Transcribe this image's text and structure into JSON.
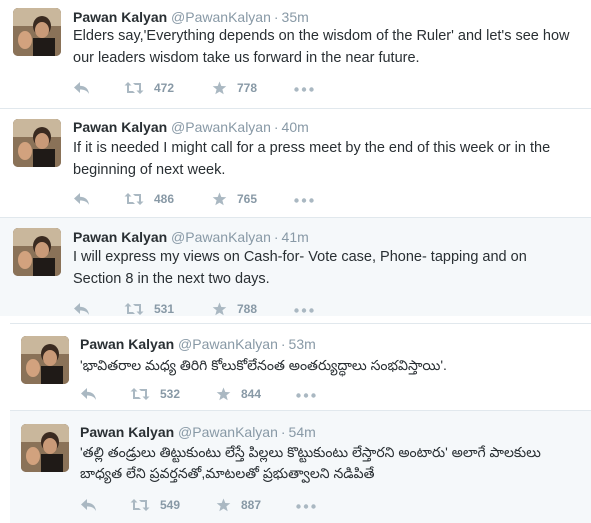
{
  "colors": {
    "name": "#292f33",
    "meta": "#8899a6",
    "highlight_bg": "#f5f8fa",
    "border": "#e1e8ed"
  },
  "icons": {
    "reply": "reply-icon",
    "retweet": "retweet-icon",
    "favorite": "star-icon",
    "more": "more-icon"
  },
  "tweets": [
    {
      "name": "Pawan Kalyan",
      "handle": "@PawanKalyan",
      "separator": "·",
      "time": "35m",
      "text": "Elders say,'Everything depends on the wisdom of the Ruler' and let's see how our leaders wisdom take us forward in the near future.",
      "retweets": "472",
      "favorites": "778"
    },
    {
      "name": "Pawan Kalyan",
      "handle": "@PawanKalyan",
      "separator": "·",
      "time": "40m",
      "text": "If it is needed I might call for a press meet by the end of this week or in the beginning of next week.",
      "retweets": "486",
      "favorites": "765"
    },
    {
      "name": "Pawan Kalyan",
      "handle": "@PawanKalyan",
      "separator": "·",
      "time": "41m",
      "text": "I will express my views on Cash-for-  Vote case, Phone- tapping and on Section 8 in the next two days.",
      "retweets": "531",
      "favorites": "788"
    },
    {
      "name": "Pawan Kalyan",
      "handle": "@PawanKalyan",
      "separator": "·",
      "time": "53m",
      "text": "'భావితరాల మధ్య తిరిగి కోలుకోలేనంత అంతర్యుద్ధాలు సంభవిస్తాయి'.",
      "retweets": "532",
      "favorites": "844"
    },
    {
      "name": "Pawan Kalyan",
      "handle": "@PawanKalyan",
      "separator": "·",
      "time": "54m",
      "text": "'తల్లి తండ్రులు తిట్టుకుంటు లేస్తే పిల్లలు కొట్టుకుంటు లేస్తారని అంటారు' అలాగే పాలకులు బాధ్యత లేని ప్రవర్తనతో,మాటలతో ప్రభుత్వాలని  నడిపితే",
      "retweets": "549",
      "favorites": "887"
    }
  ]
}
